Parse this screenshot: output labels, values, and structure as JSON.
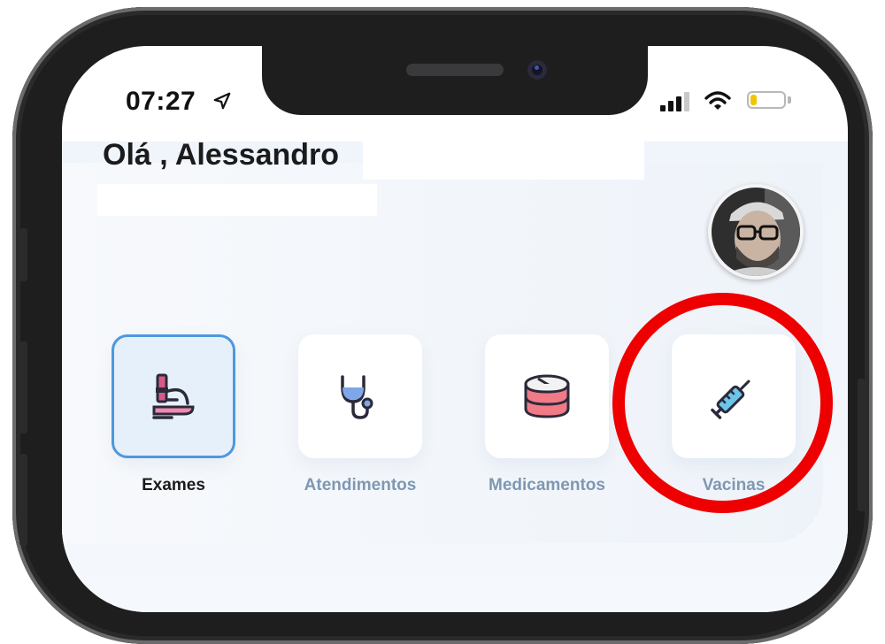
{
  "status_bar": {
    "time": "07:27",
    "location_icon": "location-arrow-icon",
    "signal_icon": "cellular-signal-icon",
    "wifi_icon": "wifi-icon",
    "battery_icon": "battery-low-icon",
    "battery_level": 0.2,
    "battery_color": "#f5c400"
  },
  "header": {
    "greeting": "Olá , Alessandro",
    "avatar_icon": "user-avatar"
  },
  "shortcuts": [
    {
      "label": "Exames",
      "icon": "microscope-icon",
      "selected": true
    },
    {
      "label": "Atendimentos",
      "icon": "stethoscope-icon",
      "selected": false
    },
    {
      "label": "Medicamentos",
      "icon": "pill-icon",
      "selected": false
    },
    {
      "label": "Vacinas",
      "icon": "syringe-icon",
      "selected": false
    }
  ],
  "colors": {
    "accent": "#4d98de",
    "label_inactive": "#7e98b3",
    "highlight": "#ee0000"
  }
}
